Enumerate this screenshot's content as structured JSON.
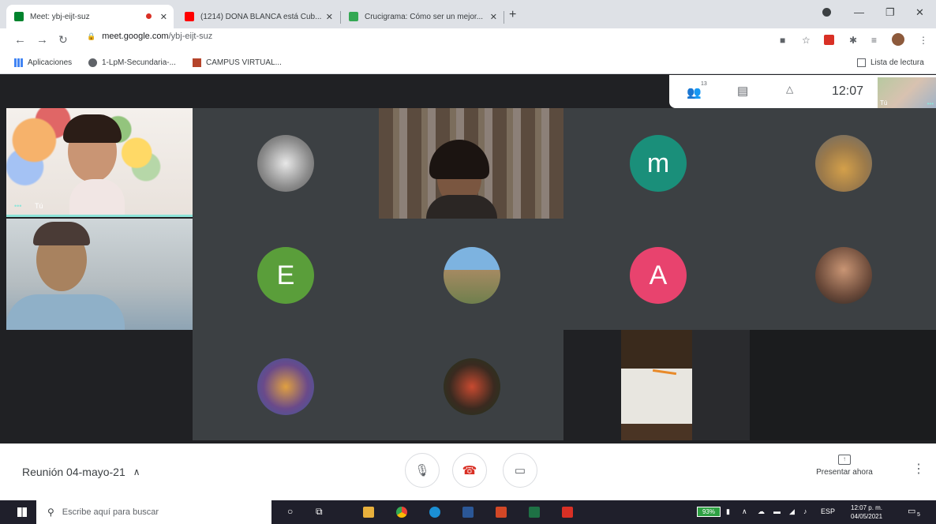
{
  "browser": {
    "tabs": [
      {
        "title": "Meet: ybj-eijt-suz",
        "active": true
      },
      {
        "title": "(1214) DOÑA BLANCA está Cub...",
        "active": false
      },
      {
        "title": "Crucigrama: Cómo ser un mejor...",
        "active": false
      }
    ],
    "url_host": "meet.google.com",
    "url_path": "/ybj-eijt-suz",
    "bookmarks": [
      "Aplicaciones",
      "1-LpM-Secundaria-...",
      "CAMPUS VIRTUAL..."
    ],
    "reading_list": "Lista de lectura"
  },
  "meet": {
    "participant_count": "13",
    "time": "12:07",
    "self_label": "Tú",
    "meeting_name": "Reunión 04-mayo-21",
    "present_label": "Presentar ahora",
    "avatars": {
      "m": {
        "letter": "m",
        "color": "#1a8f7a"
      },
      "E": {
        "letter": "E",
        "color": "#5a9e3a"
      },
      "A": {
        "letter": "A",
        "color": "#e8436e"
      }
    }
  },
  "taskbar": {
    "search_placeholder": "Escribe aquí para buscar",
    "battery": "93%",
    "language": "ESP",
    "time": "12:07 p. m.",
    "date": "04/05/2021",
    "notifications": "5"
  }
}
